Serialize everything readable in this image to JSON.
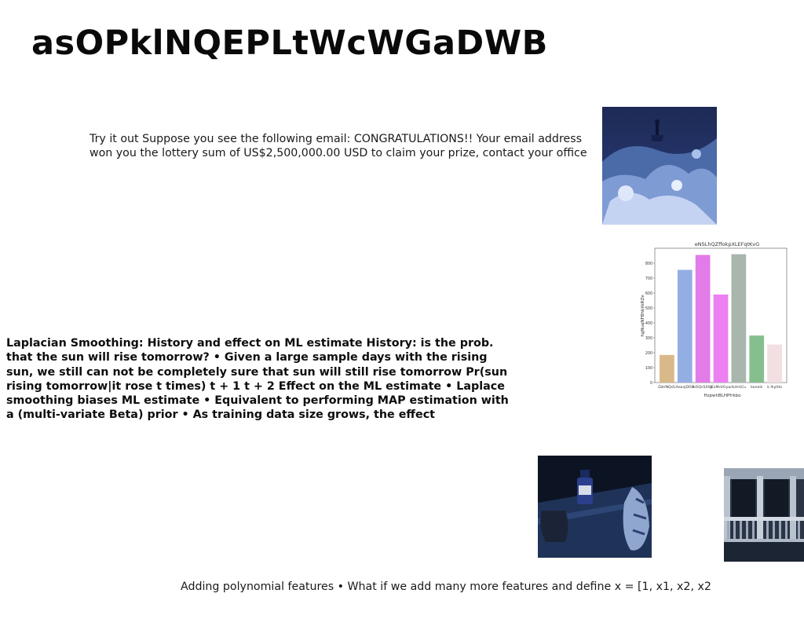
{
  "slide": {
    "title": "asOPklNQEPLtWcWGaDWB",
    "email_paragraph": "Try it out Suppose you see the following email: CONGRATULATIONS!! Your email address won you the lottery sum of US$2,500,000.00 USD to claim your prize, contact your office",
    "laplace_paragraph": "Laplacian Smoothing: History and effect on ML estimate History: is the prob. that the sun will rise tomorrow? • Given a large sample days with the rising sun, we still can not be completely sure that sun will still rise tomorrow Pr(sun rising tomorrow|it rose t times) t + 1 t + 2 Effect on the ML estimate • Laplace smoothing biases ML estimate • Equivalent to performing MAP estimation with a (multi-variate Beta) prior • As training data size grows, the effect",
    "poly_paragraph": "Adding polynomial features • What if we add many more features and define x = [1, x1, x2, x2"
  },
  "chart_data": {
    "type": "bar",
    "title": "eNSLhQZffokpXLEFqtKvG",
    "xlabel": "HzpwhBLHPfrkbo",
    "ylabel": "hgNuqNFBhbilkRZe",
    "categories": [
      "DzHNQsG",
      "AeavjDOB",
      "kOQcSXSk",
      "JEsMsVGyw",
      "tLHrkCu",
      "keneIz",
      "k IhyIHo"
    ],
    "values": [
      185,
      755,
      855,
      590,
      860,
      315,
      255
    ],
    "colors": [
      "#d9b98a",
      "#93aee3",
      "#e27ce8",
      "#ec80f0",
      "#a9b6ad",
      "#86bf8e",
      "#f1dfe1"
    ],
    "ylim": [
      0,
      900
    ],
    "yticks": [
      0,
      100,
      200,
      300,
      400,
      500,
      600,
      700,
      800
    ],
    "grid": false
  }
}
